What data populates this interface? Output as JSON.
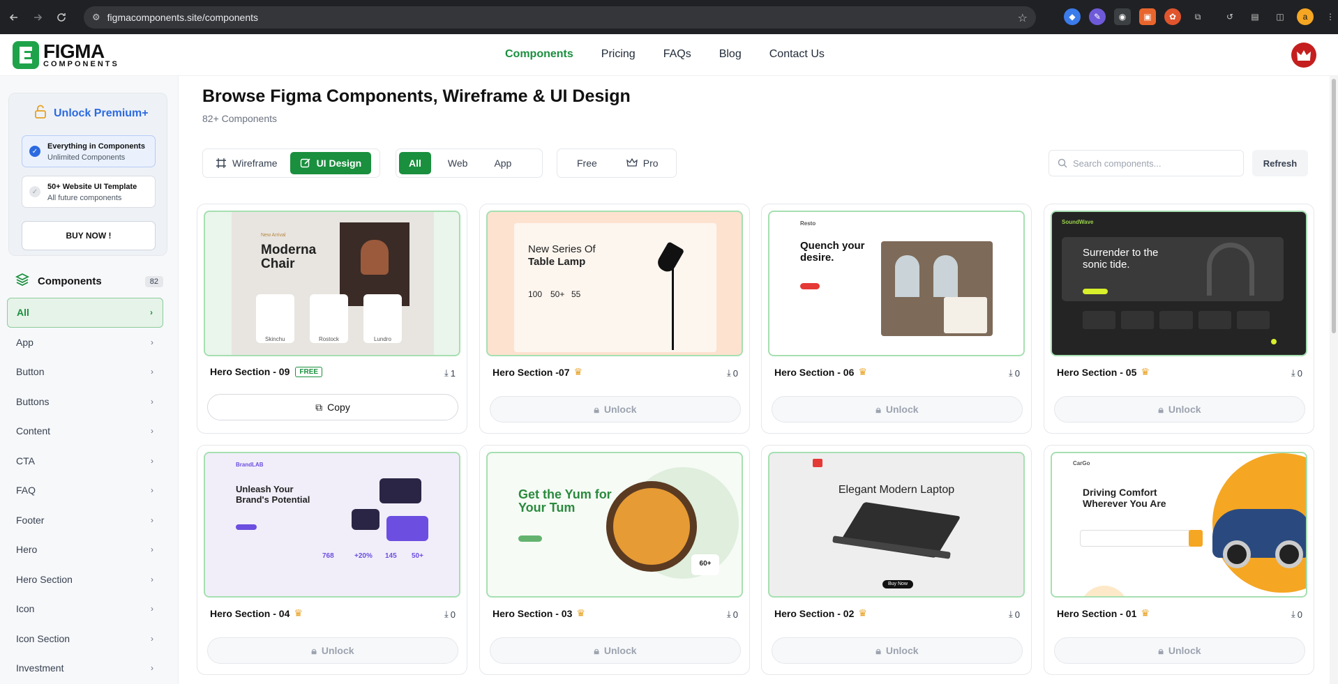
{
  "browser": {
    "url": "figmacomponents.site/components"
  },
  "header": {
    "logo_primary": "FIGMA",
    "logo_secondary": "COMPONENTS",
    "nav": [
      {
        "label": "Components",
        "active": true
      },
      {
        "label": "Pricing",
        "active": false
      },
      {
        "label": "FAQs",
        "active": false
      },
      {
        "label": "Blog",
        "active": false
      },
      {
        "label": "Contact Us",
        "active": false
      }
    ]
  },
  "sidebar": {
    "premium_title": "Unlock Premium+",
    "perks": [
      {
        "title": "Everything in Components",
        "subtitle": "Unlimited Components",
        "checked": true
      },
      {
        "title": "50+ Website UI Template",
        "subtitle": "All future components",
        "checked": false
      }
    ],
    "buy_label": "BUY NOW !",
    "categories_title": "Components",
    "categories_count": "82",
    "categories": [
      "All",
      "App",
      "Button",
      "Buttons",
      "Content",
      "CTA",
      "FAQ",
      "Footer",
      "Hero",
      "Hero Section",
      "Icon",
      "Icon Section",
      "Investment"
    ]
  },
  "main": {
    "title": "Browse Figma Components, Wireframe & UI Design",
    "subtitle": "82+ Components",
    "view_toggle": [
      "Wireframe",
      "UI Design"
    ],
    "platform_filter": [
      "All",
      "Web",
      "App"
    ],
    "price_filter": [
      "Free",
      "Pro"
    ],
    "search_placeholder": "Search components...",
    "refresh_label": "Refresh"
  },
  "cards": [
    {
      "name": "Hero Section - 09",
      "badge": "FREE",
      "downloads": "1",
      "action": "Copy",
      "preview": {
        "headline": "Moderna Chair",
        "items": [
          "Skinchu",
          "Rostock",
          "Lundro"
        ]
      }
    },
    {
      "name": "Hero Section -07",
      "downloads": "0",
      "action": "Unlock",
      "preview": {
        "headline": "New Series Of",
        "headline2": "Table Lamp",
        "stats": [
          "100",
          "50+",
          "55"
        ]
      }
    },
    {
      "name": "Hero Section - 06",
      "downloads": "0",
      "action": "Unlock",
      "preview": {
        "brand": "Resto",
        "headline": "Quench your desire."
      }
    },
    {
      "name": "Hero Section - 05",
      "downloads": "0",
      "action": "Unlock",
      "preview": {
        "brand": "SoundWave",
        "headline": "Surrender to the sonic tide."
      }
    },
    {
      "name": "Hero Section - 04",
      "downloads": "0",
      "action": "Unlock",
      "preview": {
        "brand": "BrandLAB",
        "headline": "Unleash Your Brand's Potential",
        "stats": [
          "768",
          "+20%",
          "145",
          "50+"
        ]
      }
    },
    {
      "name": "Hero Section - 03",
      "downloads": "0",
      "action": "Unlock",
      "preview": {
        "headline": "Get the Yum for Your Tum",
        "badge": "60+"
      }
    },
    {
      "name": "Hero Section - 02",
      "downloads": "0",
      "action": "Unlock",
      "preview": {
        "headline": "Elegant Modern Laptop",
        "cta": "Buy Now"
      }
    },
    {
      "name": "Hero Section - 01",
      "downloads": "0",
      "action": "Unlock",
      "preview": {
        "brand": "CarGo",
        "headline": "Driving Comfort Wherever You Are"
      }
    }
  ],
  "colors": {
    "brand_green": "#1a8f3e",
    "premium_blue": "#2c6ae0",
    "pro_crown": "#e8a020"
  }
}
